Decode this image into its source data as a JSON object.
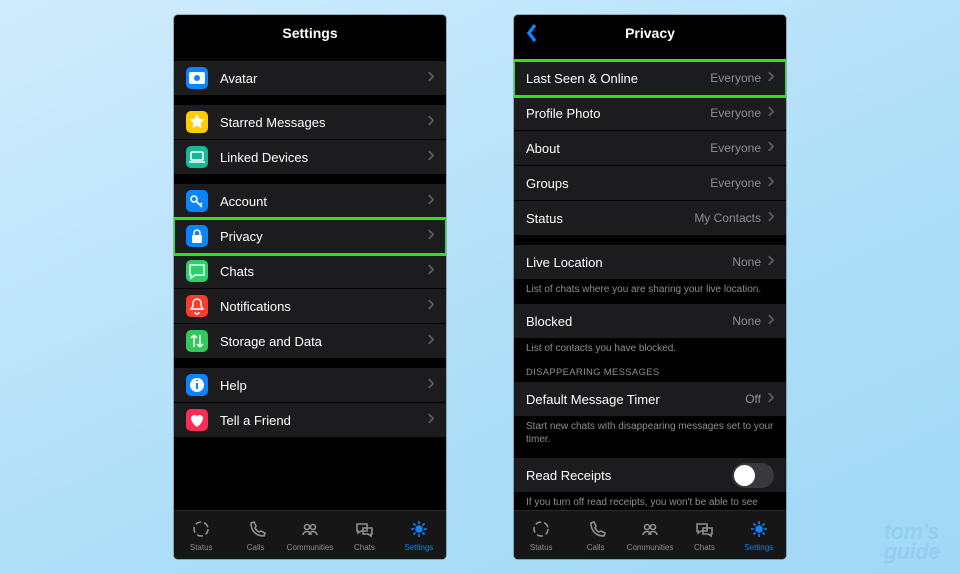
{
  "left": {
    "title": "Settings",
    "groups": [
      [
        {
          "iconColor": "#0a84ff",
          "icon": "avatar",
          "label": "Avatar"
        }
      ],
      [
        {
          "iconColor": "#ffcc00",
          "icon": "star",
          "label": "Starred Messages"
        },
        {
          "iconColor": "#18b79a",
          "icon": "laptop",
          "label": "Linked Devices"
        }
      ],
      [
        {
          "iconColor": "#0a84ff",
          "icon": "key",
          "label": "Account"
        },
        {
          "iconColor": "#0a84ff",
          "icon": "lock",
          "label": "Privacy",
          "highlight": true
        },
        {
          "iconColor": "#25D366",
          "icon": "bubble",
          "label": "Chats"
        },
        {
          "iconColor": "#ff3b30",
          "icon": "bell",
          "label": "Notifications"
        },
        {
          "iconColor": "#34c759",
          "icon": "arrows",
          "label": "Storage and Data"
        }
      ],
      [
        {
          "iconColor": "#0a84ff",
          "icon": "info",
          "label": "Help"
        },
        {
          "iconColor": "#ff2d55",
          "icon": "heart",
          "label": "Tell a Friend"
        }
      ]
    ]
  },
  "right": {
    "title": "Privacy",
    "g1": [
      {
        "label": "Last Seen & Online",
        "value": "Everyone",
        "highlight": true
      },
      {
        "label": "Profile Photo",
        "value": "Everyone"
      },
      {
        "label": "About",
        "value": "Everyone"
      },
      {
        "label": "Groups",
        "value": "Everyone"
      },
      {
        "label": "Status",
        "value": "My Contacts"
      }
    ],
    "g2": [
      {
        "label": "Live Location",
        "value": "None"
      }
    ],
    "g2_hint": "List of chats where you are sharing your live location.",
    "g3": [
      {
        "label": "Blocked",
        "value": "None"
      }
    ],
    "g3_hint": "List of contacts you have blocked.",
    "g4_hdr": "DISAPPEARING MESSAGES",
    "g4": [
      {
        "label": "Default Message Timer",
        "value": "Off"
      }
    ],
    "g4_hint": "Start new chats with disappearing messages set to your timer.",
    "g5_label": "Read Receipts",
    "g5_hint": "If you turn off read receipts, you won't be able to see read"
  },
  "tabs": [
    {
      "label": "Status",
      "icon": "ring"
    },
    {
      "label": "Calls",
      "icon": "phone"
    },
    {
      "label": "Communities",
      "icon": "people"
    },
    {
      "label": "Chats",
      "icon": "bubbles"
    },
    {
      "label": "Settings",
      "icon": "gear",
      "active": true
    }
  ],
  "logo": {
    "l1": "tom's",
    "l2": "guide"
  }
}
